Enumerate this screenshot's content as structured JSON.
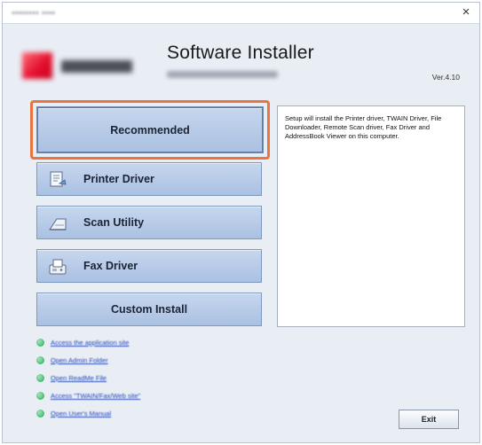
{
  "window": {
    "title": "•••••••• ••••",
    "close_glyph": "×"
  },
  "header": {
    "app_title": "Software Installer",
    "version": "Ver.4.10",
    "brand_color": "#e30c2a"
  },
  "buttons": {
    "recommended": "Recommended",
    "printer_driver": "Printer Driver",
    "scan_utility": "Scan Utility",
    "fax_driver": "Fax Driver",
    "custom_install": "Custom Install"
  },
  "icons": {
    "printer_driver": "printer-driver-icon",
    "scan_utility": "scanner-icon",
    "fax_driver": "fax-icon"
  },
  "description": "Setup will install the Printer driver, TWAIN Driver, File Downloader, Remote Scan driver, Fax Driver and AddressBook Viewer on this computer.",
  "links": [
    "Access the application site",
    "Open Admin Folder",
    "Open ReadMe File",
    "Access \"TWAIN/Fax/Web site\"",
    "Open User's Manual"
  ],
  "exit_label": "Exit",
  "colors": {
    "highlight": "#e9743f",
    "button": "#b6cae8",
    "link": "#2146b8"
  }
}
